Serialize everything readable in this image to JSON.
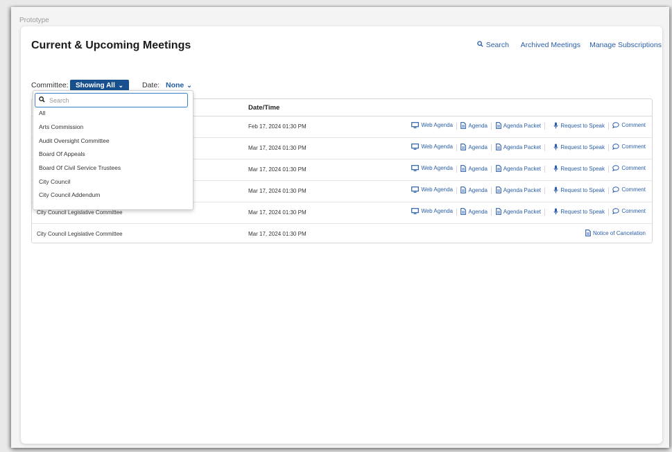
{
  "prototype_label": "Prototype",
  "page_title": "Current & Upcoming Meetings",
  "top_links": {
    "search": "Search",
    "archived": "Archived Meetings",
    "subscriptions": "Manage Subscriptions"
  },
  "filters": {
    "committee_label": "Committee:",
    "committee_value": "Showing All",
    "date_label": "Date:",
    "date_value": "None"
  },
  "dropdown": {
    "search_placeholder": "Search",
    "options": [
      "All",
      "Arts Commission",
      "Audit Oversight Committee",
      "Board Of Appeals",
      "Board Of Civil Service Trustees",
      "City Council",
      "City Council Addendum"
    ]
  },
  "table": {
    "date_header": "Date/Time",
    "rows": [
      {
        "name": "",
        "date": "Feb 17, 2024 01:30 PM"
      },
      {
        "name": "",
        "date": "Mar 17, 2024 01:30 PM"
      },
      {
        "name": "",
        "date": "Mar 17, 2024 01:30 PM"
      },
      {
        "name": "",
        "date": "Mar 17, 2024 01:30 PM"
      },
      {
        "name": "City Council Legislative Committee",
        "date": "Mar 17, 2024 01:30 PM"
      },
      {
        "name": "City Council Legislative Committee",
        "date": "Mar 17, 2024 01:30 PM"
      }
    ],
    "actions": {
      "web_agenda": "Web Agenda",
      "agenda": "Agenda",
      "agenda_packet": "Agenda Packet",
      "request_to_speak": "Request to Speak",
      "comment": "Comment",
      "notice_cancel": "Notice of Cancelation"
    }
  },
  "colors": {
    "accent": "#18508f",
    "link": "#2a5ea8"
  }
}
